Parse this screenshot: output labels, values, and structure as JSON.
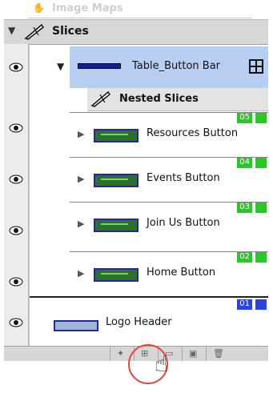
{
  "tab_title": "Image Maps",
  "group": {
    "label": "Slices"
  },
  "table_bar": {
    "label": "Table_Button Bar"
  },
  "nested": {
    "label": "Nested Slices"
  },
  "rows": [
    {
      "badge": "05",
      "label": "Resources Button"
    },
    {
      "badge": "04",
      "label": "Events Button"
    },
    {
      "badge": "03",
      "label": "Join Us Button"
    },
    {
      "badge": "02",
      "label": "Home Button"
    }
  ],
  "logo": {
    "badge": "01",
    "label": "Logo Header"
  }
}
